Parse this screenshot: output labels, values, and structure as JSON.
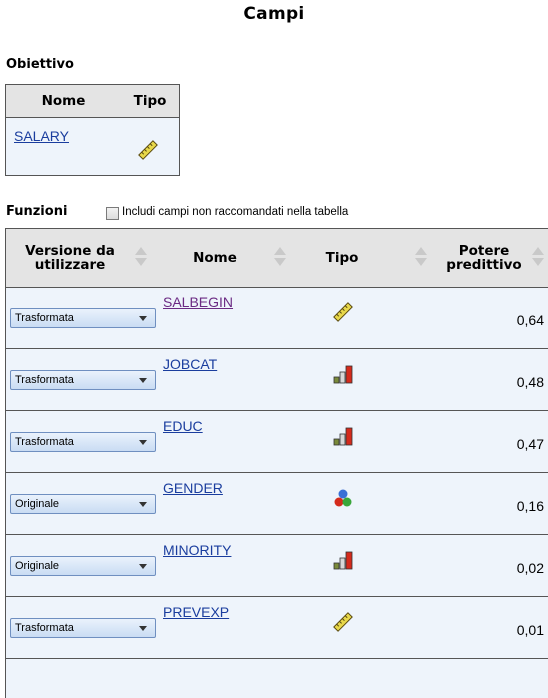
{
  "page_title": "Campi",
  "target": {
    "section_label": "Obiettivo",
    "headers": {
      "name": "Nome",
      "type": "Tipo"
    },
    "rows": [
      {
        "name": "SALARY",
        "type_icon": "ruler-icon"
      }
    ]
  },
  "features": {
    "section_label": "Funzioni",
    "include_checkbox": {
      "label": "Includi campi non raccomandati nella tabella",
      "checked": false
    },
    "headers": {
      "version": "Versione da utilizzare",
      "name": "Nome",
      "type": "Tipo",
      "power": "Potere predittivo"
    },
    "rows": [
      {
        "version": "Trasformata",
        "name": "SALBEGIN",
        "type_icon": "ruler-icon",
        "power": "0,64"
      },
      {
        "version": "Trasformata",
        "name": "JOBCAT",
        "type_icon": "bar-chart-icon",
        "power": "0,48"
      },
      {
        "version": "Trasformata",
        "name": "EDUC",
        "type_icon": "bar-chart-icon",
        "power": "0,47"
      },
      {
        "version": "Originale",
        "name": "GENDER",
        "type_icon": "nominal-spheres-icon",
        "power": "0,16"
      },
      {
        "version": "Originale",
        "name": "MINORITY",
        "type_icon": "bar-chart-icon",
        "power": "0,02"
      },
      {
        "version": "Trasformata",
        "name": "PREVEXP",
        "type_icon": "ruler-icon",
        "power": "0,01"
      }
    ]
  },
  "colors": {
    "link": "#1a3d9e",
    "visited_link": "#6b2a83",
    "row_bg": "#eef4fb",
    "header_bg": "#e4e4e4"
  }
}
